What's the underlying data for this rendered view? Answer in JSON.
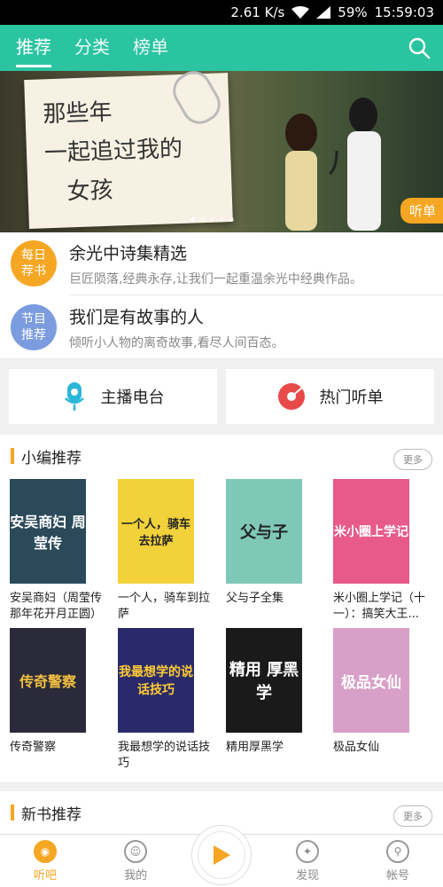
{
  "status": {
    "speed": "2.61 K/s",
    "battery": "59%",
    "time": "15:59:03"
  },
  "tabs": [
    {
      "label": "推荐",
      "active": true
    },
    {
      "label": "分类",
      "active": false
    },
    {
      "label": "榜单",
      "active": false
    }
  ],
  "banner": {
    "note_line1": "那些年",
    "note_line2": "一起追过我的",
    "note_line3": "女孩",
    "tag": "听单"
  },
  "daily": [
    {
      "badge": "每日荐书",
      "badge_color": "#f5a623",
      "title": "余光中诗集精选",
      "subtitle": "巨匠陨落,经典永存,让我们一起重温余光中经典作品。"
    },
    {
      "badge": "节目推荐",
      "badge_color": "#7b9cdf",
      "title": "我们是有故事的人",
      "subtitle": "倾听小人物的离奇故事,看尽人间百态。"
    }
  ],
  "quick": [
    {
      "label": "主播电台",
      "icon": "microphone-icon",
      "color": "#2bb7d8"
    },
    {
      "label": "热门听单",
      "icon": "cd-icon",
      "color": "#e84a4a"
    }
  ],
  "editor_pick": {
    "title": "小编推荐",
    "more": "更多",
    "books": [
      {
        "title": "安吴商妇（周莹传那年花开月正圆）",
        "cover_text": "安吴商妇 周莹传",
        "bg": "#2a4a5a",
        "fg": "#fff"
      },
      {
        "title": "一个人，骑车到拉萨",
        "cover_text": "一个人，骑车去拉萨",
        "bg": "#f2d23b",
        "fg": "#222"
      },
      {
        "title": "父与子全集",
        "cover_text": "父与子",
        "bg": "#7fc8b8",
        "fg": "#222"
      },
      {
        "title": "米小圈上学记（十一）：搞笑大王...",
        "cover_text": "米小圈上学记",
        "bg": "#e85a8a",
        "fg": "#fff"
      },
      {
        "title": "传奇警察",
        "cover_text": "传奇警察",
        "bg": "#2a2a3a",
        "fg": "#f2c040"
      },
      {
        "title": "我最想学的说话技巧",
        "cover_text": "我最想学的说话技巧",
        "bg": "#2a2a6a",
        "fg": "#ffcc33"
      },
      {
        "title": "精用厚黑学",
        "cover_text": "精用 厚黑学",
        "bg": "#1a1a1a",
        "fg": "#fff"
      },
      {
        "title": "极品女仙",
        "cover_text": "极品女仙",
        "bg": "#d8a0c8",
        "fg": "#fff"
      }
    ]
  },
  "new_books": {
    "title": "新书推荐",
    "more": "更多"
  },
  "tabbar": [
    {
      "label": "听吧",
      "active": true,
      "icon": "listen-icon"
    },
    {
      "label": "我的",
      "active": false,
      "icon": "profile-icon"
    },
    {
      "label": "发现",
      "active": false,
      "icon": "compass-icon"
    },
    {
      "label": "帐号",
      "active": false,
      "icon": "account-icon"
    }
  ],
  "colors": {
    "primary": "#2bc4a0",
    "accent": "#f5a623"
  }
}
